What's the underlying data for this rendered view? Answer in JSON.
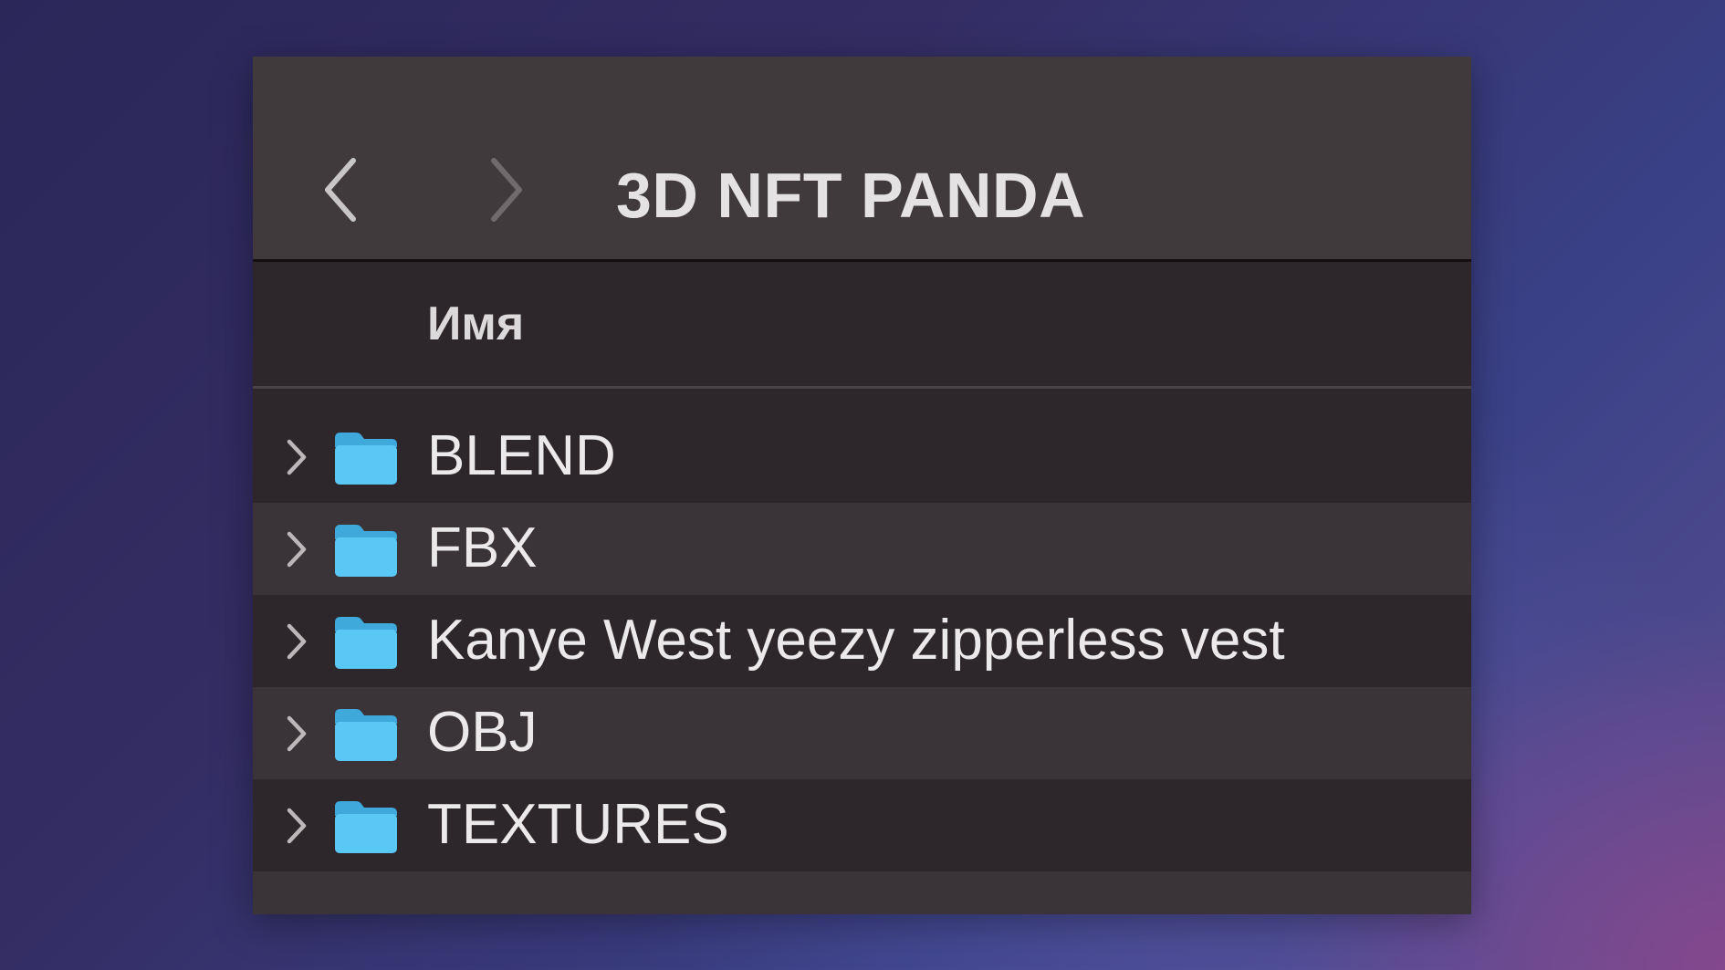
{
  "window": {
    "title": "3D NFT PANDA"
  },
  "toolbar": {
    "back_icon": "chevron-left-icon",
    "forward_icon": "chevron-right-icon"
  },
  "list_header": {
    "name_column": "Имя"
  },
  "files": [
    {
      "name": "BLEND",
      "type": "folder",
      "icon": "folder-icon",
      "expanded": false
    },
    {
      "name": "FBX",
      "type": "folder",
      "icon": "folder-icon",
      "expanded": false
    },
    {
      "name": "Kanye West yeezy zipperless vest",
      "type": "folder",
      "icon": "folder-icon",
      "expanded": false
    },
    {
      "name": "OBJ",
      "type": "folder",
      "icon": "folder-icon",
      "expanded": false
    },
    {
      "name": "TEXTURES",
      "type": "folder",
      "icon": "folder-icon",
      "expanded": false
    }
  ],
  "colors": {
    "toolbar_bg": "#403a3d",
    "list_bg": "#2d262a",
    "row_alt_bg": "#3a3337",
    "folder_blue": "#5ac8f5",
    "text": "#ebe9ea"
  }
}
